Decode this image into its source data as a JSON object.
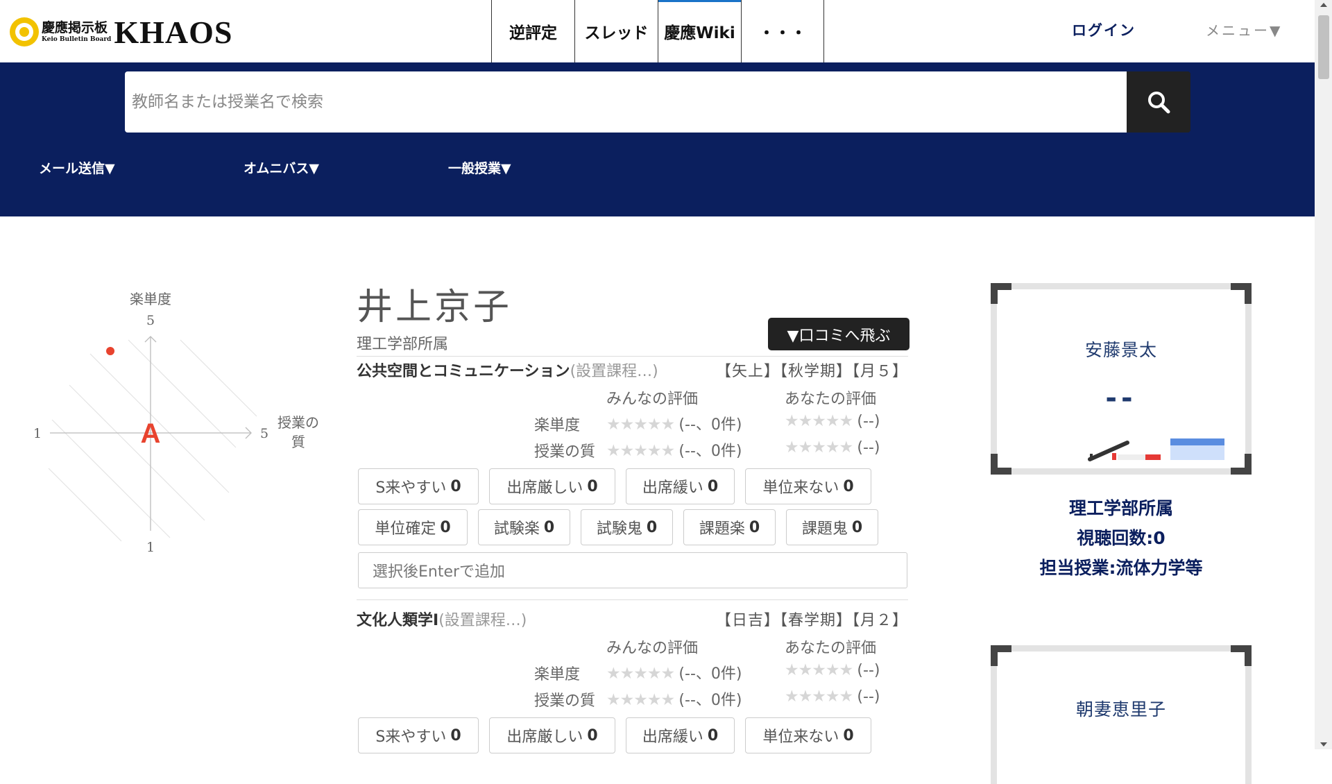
{
  "header": {
    "logo": {
      "jp": "慶應掲示板",
      "en": "Keio Bulletin Board",
      "main": "KHAOS"
    },
    "nav_tabs": [
      {
        "label": "逆評定"
      },
      {
        "label": "スレッド"
      },
      {
        "label": "慶應Wiki"
      },
      {
        "label": "・・・"
      }
    ],
    "login_label": "ログイン",
    "menu_label": "メニュー▼"
  },
  "search": {
    "placeholder": "教師名または授業名で検索",
    "button_icon": "search-icon"
  },
  "subnav": [
    {
      "label": "メール送信▼"
    },
    {
      "label": "オムニバス▼"
    },
    {
      "label": "一般授業▼"
    }
  ],
  "chart": {
    "y_label": "楽単度",
    "x_label_line1": "授業の",
    "x_label_line2": "質",
    "y_max_tick": "5",
    "y_min_tick": "1",
    "x_min_tick": "1",
    "x_max_tick": "5",
    "grade": "A",
    "grade_color": "#e8432e",
    "point_color": "#e8432e"
  },
  "professor": {
    "name": "井上京子",
    "affiliation": "理工学部所属",
    "jump_button": "▼口コミへ飛ぶ"
  },
  "rating_headers": {
    "everyone": "みんなの評価",
    "yours": "あなたの評価"
  },
  "rating_labels": {
    "ease": "楽単度",
    "quality": "授業の質"
  },
  "stars_glyph": "★★★★★",
  "rating_values": {
    "everyone": "(--、0件)",
    "yours": "(--)"
  },
  "courses": [
    {
      "title": "公共空間とコミュニケーション",
      "note": "(設置課程…)",
      "tags_text": "【矢上】【秋学期】【月５】",
      "tag_buttons": [
        {
          "label": "S来やすい",
          "count": "0"
        },
        {
          "label": "出席厳しい",
          "count": "0"
        },
        {
          "label": "出席緩い",
          "count": "0"
        },
        {
          "label": "単位来ない",
          "count": "0"
        },
        {
          "label": "単位確定",
          "count": "0"
        },
        {
          "label": "試験楽",
          "count": "0"
        },
        {
          "label": "試験鬼",
          "count": "0"
        },
        {
          "label": "課題楽",
          "count": "0"
        },
        {
          "label": "課題鬼",
          "count": "0"
        }
      ],
      "add_input_placeholder": "選択後Enterで追加"
    },
    {
      "title": "文化人類学Ⅰ",
      "note": "(設置課程…)",
      "tags_text": "【日吉】【春学期】【月２】",
      "tag_buttons": [
        {
          "label": "S来やすい",
          "count": "0"
        },
        {
          "label": "出席厳しい",
          "count": "0"
        },
        {
          "label": "出席緩い",
          "count": "0"
        },
        {
          "label": "単位来ない",
          "count": "0"
        }
      ]
    }
  ],
  "related": [
    {
      "name": "安藤景太",
      "score": "--",
      "affiliation": "理工学部所属",
      "views": "視聴回数:0",
      "courses": "担当授業:流体力学等"
    },
    {
      "name": "朝妻恵里子"
    }
  ],
  "colors": {
    "navy": "#0b1f5e",
    "accent_blue": "#1a73c8"
  }
}
